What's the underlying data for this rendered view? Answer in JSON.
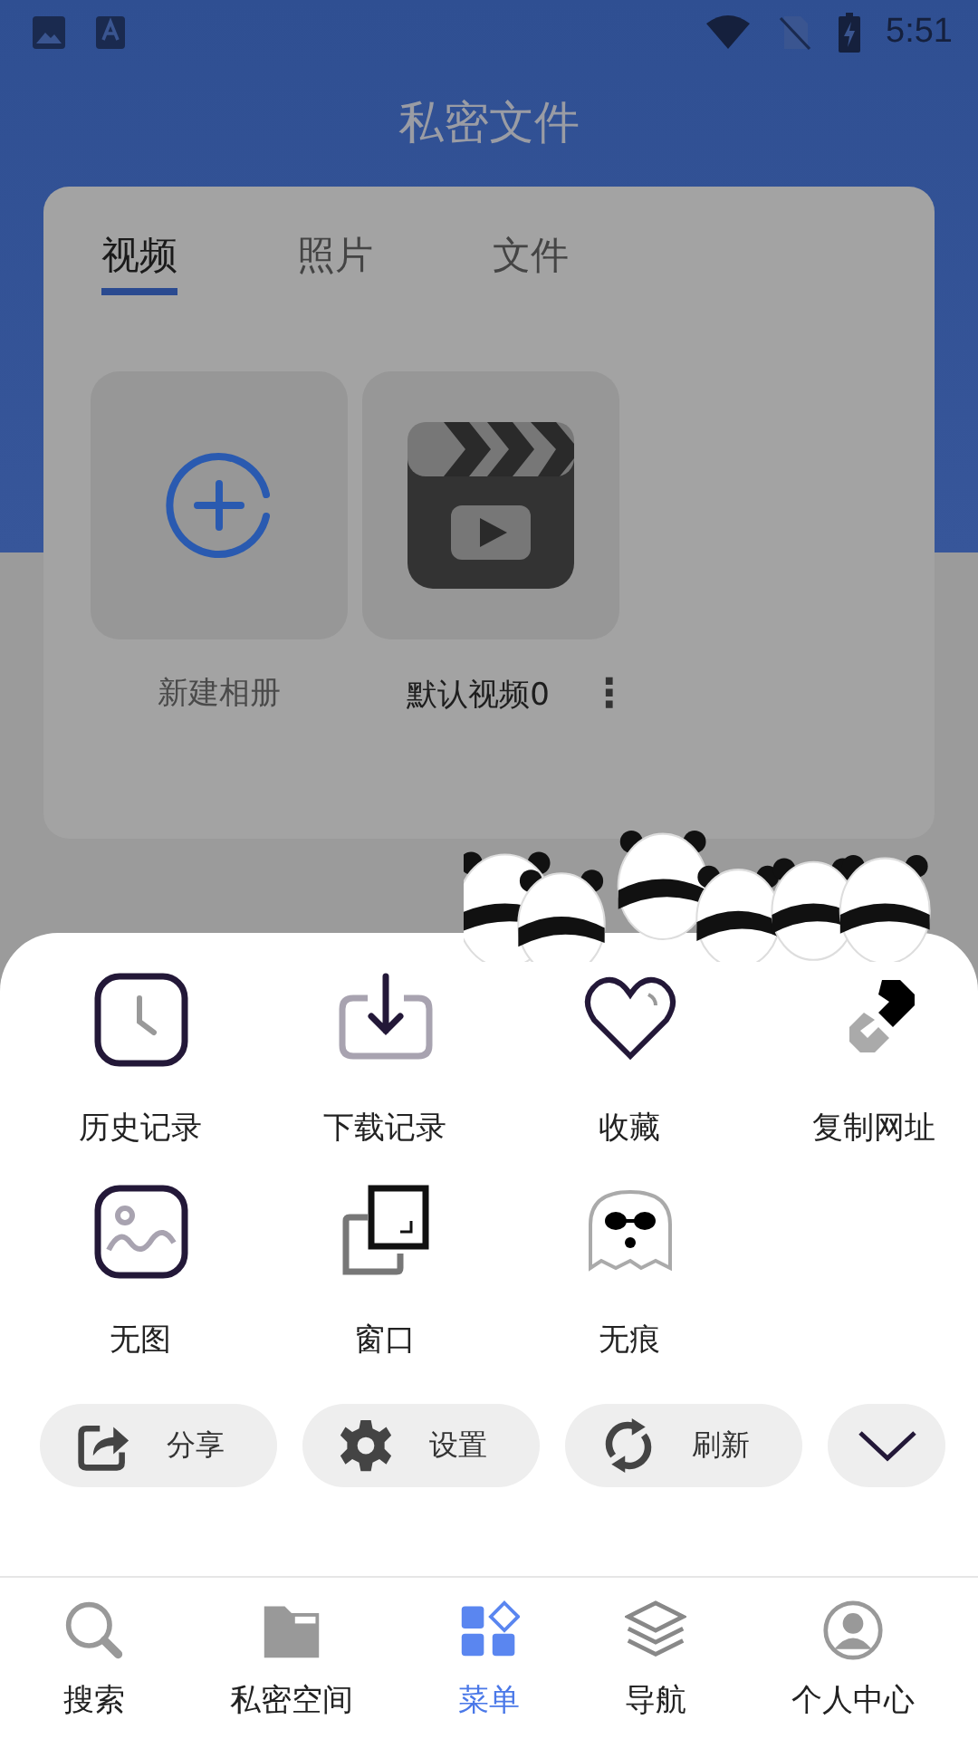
{
  "status_bar": {
    "time": "5:51"
  },
  "header": {
    "title": "私密文件"
  },
  "tabs": [
    {
      "label": "视频",
      "selected": true
    },
    {
      "label": "照片",
      "selected": false
    },
    {
      "label": "文件",
      "selected": false
    }
  ],
  "albums": [
    {
      "kind": "add",
      "label": "新建相册"
    },
    {
      "kind": "video",
      "label": "默认视频0",
      "more": "⋮"
    }
  ],
  "menu": {
    "items": [
      {
        "kind": "history",
        "label": "历史记录"
      },
      {
        "kind": "download",
        "label": "下载记录"
      },
      {
        "kind": "favorite",
        "label": "收藏"
      },
      {
        "kind": "link",
        "label": "复制网址"
      },
      {
        "kind": "noimage",
        "label": "无图"
      },
      {
        "kind": "window",
        "label": "窗口"
      },
      {
        "kind": "incognito",
        "label": "无痕"
      }
    ],
    "actions": [
      {
        "kind": "share",
        "label": "分享"
      },
      {
        "kind": "settings",
        "label": "设置"
      },
      {
        "kind": "refresh",
        "label": "刷新"
      }
    ]
  },
  "bottom_nav": [
    {
      "kind": "search",
      "label": "搜索",
      "selected": false
    },
    {
      "kind": "private",
      "label": "私密空间",
      "selected": false
    },
    {
      "kind": "menu",
      "label": "菜单",
      "selected": true
    },
    {
      "kind": "navigation",
      "label": "导航",
      "selected": false
    },
    {
      "kind": "profile",
      "label": "个人中心",
      "selected": false
    }
  ]
}
